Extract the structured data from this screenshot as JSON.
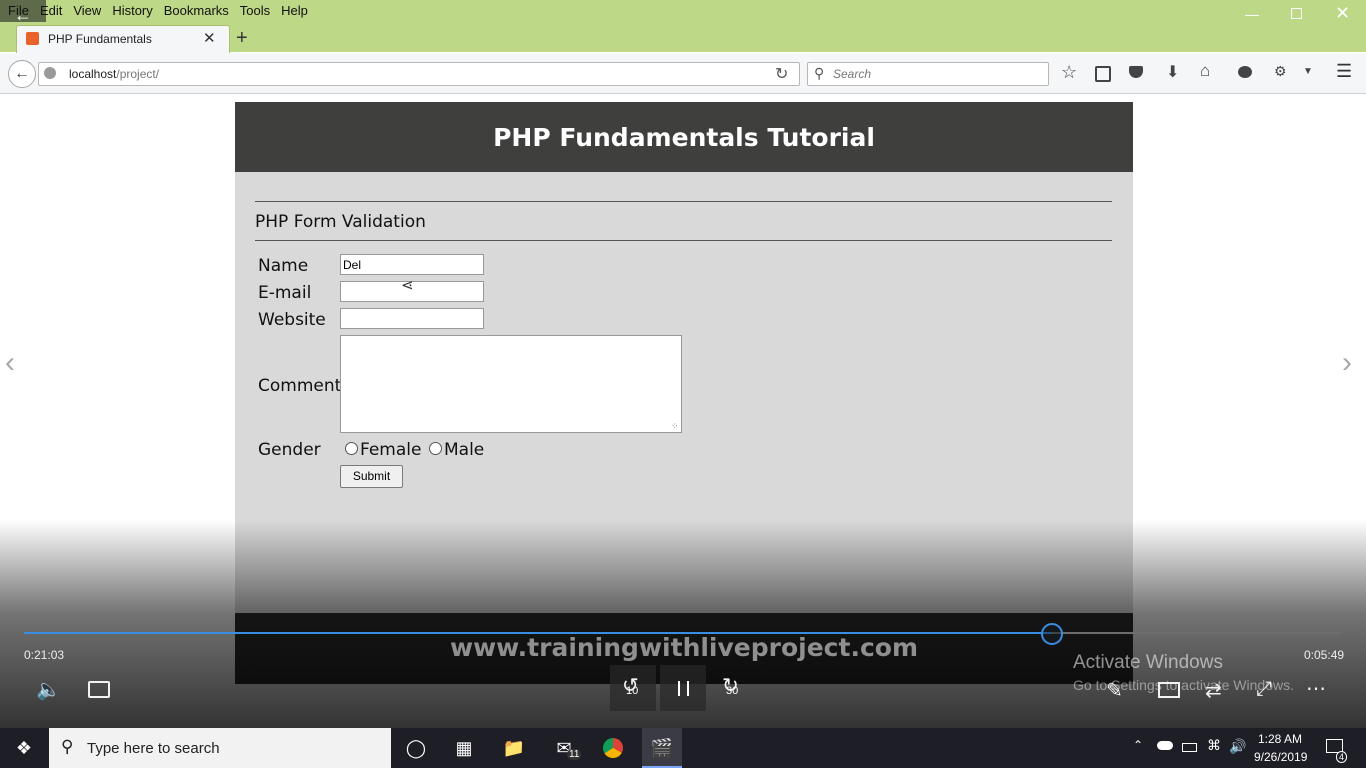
{
  "browser": {
    "menu": [
      "File",
      "Edit",
      "View",
      "History",
      "Bookmarks",
      "Tools",
      "Help"
    ],
    "tab_title": "PHP Fundamentals",
    "url_host": "localhost",
    "url_path": "/project/",
    "search_placeholder": "Search"
  },
  "page": {
    "title": "PHP Fundamentals Tutorial",
    "section_title": "PHP Form Validation",
    "labels": {
      "name": "Name",
      "email": "E-mail",
      "website": "Website",
      "comment": "Comment",
      "gender": "Gender"
    },
    "values": {
      "name": "Del",
      "email": "",
      "website": "",
      "comment": ""
    },
    "gender_options": [
      "Female",
      "Male"
    ],
    "submit_label": "Submit",
    "footer_text": "www.trainingwithliveproject.com"
  },
  "player": {
    "elapsed": "0:21:03",
    "remaining": "0:05:49",
    "progress_fraction": 0.78,
    "skip_back": "10",
    "skip_forward": "30",
    "watermark_line1": "Activate Windows",
    "watermark_line2": "Go to Settings to activate Windows."
  },
  "taskbar": {
    "search_placeholder": "Type here to search",
    "mail_badge": "11",
    "time": "1:28 AM",
    "date": "9/26/2019",
    "notification_count": "4"
  }
}
